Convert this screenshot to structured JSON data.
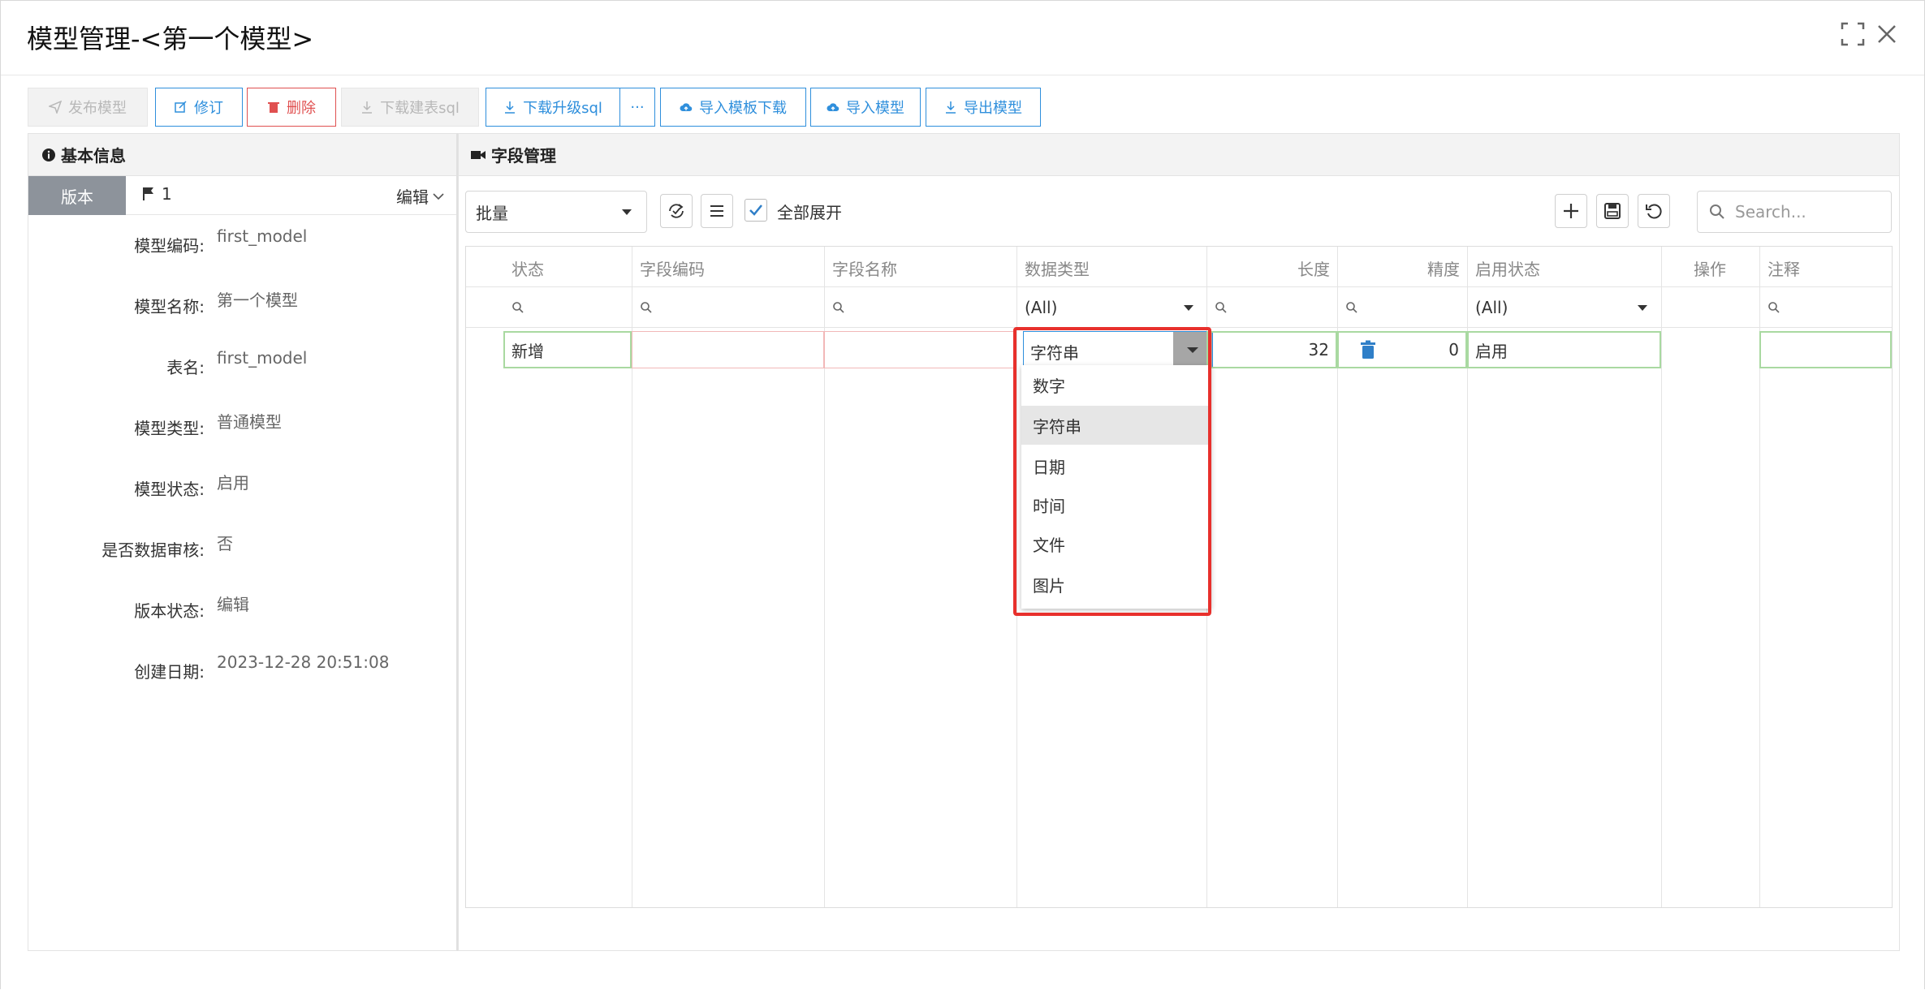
{
  "window": {
    "title": "模型管理-<第一个模型>"
  },
  "toolbar": {
    "publish": "发布模型",
    "revise": "修订",
    "delete": "删除",
    "download_create_sql": "下载建表sql",
    "download_upgrade_sql": "下载升级sql",
    "more": "···",
    "import_template_download": "导入模板下载",
    "import_model": "导入模型",
    "export_model": "导出模型"
  },
  "left": {
    "title": "基本信息",
    "version_tab": "版本",
    "version_number": "1",
    "edit": "编辑",
    "fields": [
      {
        "label": "模型编码:",
        "value": "first_model"
      },
      {
        "label": "模型名称:",
        "value": "第一个模型"
      },
      {
        "label": "表名:",
        "value": "first_model"
      },
      {
        "label": "模型类型:",
        "value": "普通模型"
      },
      {
        "label": "模型状态:",
        "value": "启用"
      },
      {
        "label": "是否数据审核:",
        "value": "否"
      },
      {
        "label": "版本状态:",
        "value": "编辑"
      },
      {
        "label": "创建日期:",
        "value": "2023-12-28 20:51:08"
      }
    ]
  },
  "right": {
    "title": "字段管理",
    "batch": "批量",
    "expand_all": "全部展开",
    "search_placeholder": "Search...",
    "columns": [
      "状态",
      "字段编码",
      "字段名称",
      "数据类型",
      "长度",
      "精度",
      "启用状态",
      "操作",
      "注释"
    ],
    "filter_all": "(All)",
    "row": {
      "status": "新增",
      "code": "",
      "name": "",
      "type": "字符串",
      "length": "32",
      "precision": "0",
      "enabled": "启用",
      "comment": ""
    },
    "dropdown_options": [
      "数字",
      "字符串",
      "日期",
      "时间",
      "文件",
      "图片"
    ]
  },
  "colors": {
    "accent": "#2f8fdc",
    "danger": "#e05050",
    "highlight": "#e8302c"
  }
}
